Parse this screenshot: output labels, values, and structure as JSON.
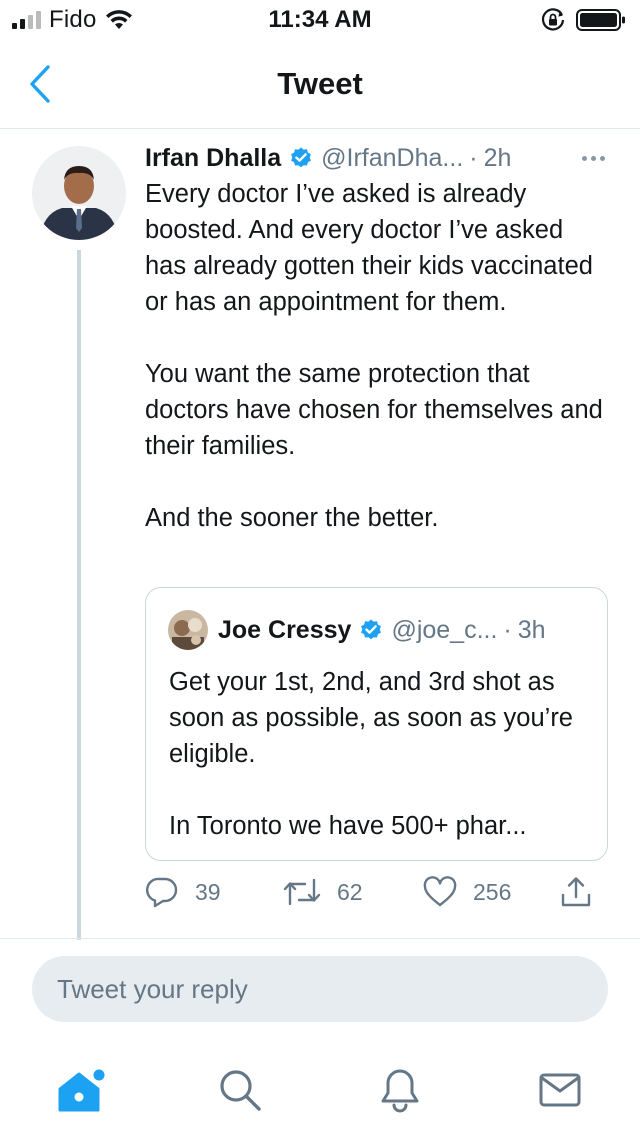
{
  "status_bar": {
    "carrier": "Fido",
    "time": "11:34 AM"
  },
  "nav": {
    "title": "Tweet",
    "back_icon": "chevron-left-icon"
  },
  "tweet": {
    "author_name": "Irfan Dhalla",
    "handle": "@IrfanDha...",
    "separator": "·",
    "time": "2h",
    "paragraphs": [
      "Every doctor I’ve asked is already boosted. And every doctor I’ve asked has already gotten their kids vaccinated or has an appointment for them.",
      "You want the same protection that doctors have chosen for themselves and their families.",
      "And the sooner the better."
    ],
    "quoted": {
      "author_name": "Joe Cressy",
      "handle": "@joe_c...",
      "separator": "·",
      "time": "3h",
      "paragraphs": [
        "Get your 1st, 2nd, and 3rd shot as soon as possible, as soon as you’re eligible.",
        "In Toronto we have 500+ phar..."
      ]
    },
    "actions": {
      "replies": "39",
      "retweets": "62",
      "likes": "256"
    }
  },
  "reply": {
    "placeholder": "Tweet your reply"
  },
  "tabbar": {
    "items": [
      "home-icon",
      "search-icon",
      "notifications-icon",
      "messages-icon"
    ],
    "active": "home-icon"
  },
  "colors": {
    "accent": "#1da1f2",
    "secondary_text": "#657786",
    "divider": "#e1e8ed",
    "reply_bg": "#e6ecf0"
  }
}
